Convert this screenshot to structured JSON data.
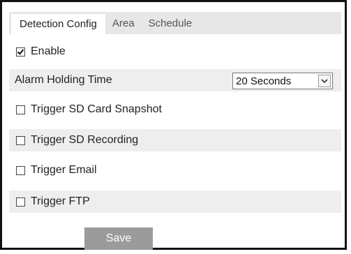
{
  "tabs": [
    {
      "label": "Detection Config",
      "active": true
    },
    {
      "label": "Area",
      "active": false
    },
    {
      "label": "Schedule",
      "active": false
    }
  ],
  "enable": {
    "label": "Enable",
    "checked": true
  },
  "alarm_holding_time": {
    "label": "Alarm Holding Time",
    "selected": "20 Seconds"
  },
  "triggers": [
    {
      "label": "Trigger SD Card Snapshot",
      "checked": false
    },
    {
      "label": "Trigger SD Recording",
      "checked": false
    },
    {
      "label": "Trigger Email",
      "checked": false
    },
    {
      "label": "Trigger FTP",
      "checked": false
    }
  ],
  "save_label": "Save",
  "colors": {
    "tabbar_bg": "#e7e7e7",
    "row_shade": "#eeeeee",
    "save_bg": "#9b9b9b"
  }
}
